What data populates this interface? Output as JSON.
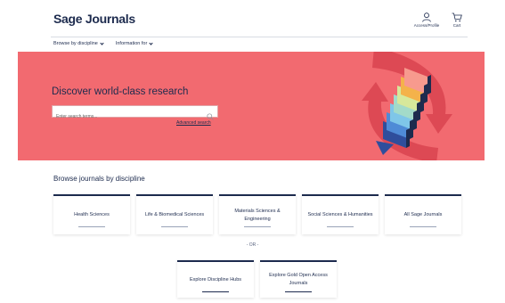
{
  "header": {
    "logo": "Sage Journals",
    "account_label": "Access/Profile",
    "cart_label": "Cart"
  },
  "nav": {
    "items": [
      {
        "label": "Browse by discipline"
      },
      {
        "label": "Information for"
      }
    ]
  },
  "hero": {
    "title": "Discover world-class research",
    "search_placeholder": "Enter search terms...",
    "advanced_search": "Advanced search",
    "background_color": "#f26a70"
  },
  "browse": {
    "title": "Browse journals by discipline",
    "cards": [
      {
        "label": "Health Sciences"
      },
      {
        "label": "Life & Biomedical Sciences"
      },
      {
        "label": "Materials Sciences & Engineering"
      },
      {
        "label": "Social Sciences & Humanities"
      },
      {
        "label": "All Sage Journals"
      }
    ],
    "or_label": "- OR -"
  },
  "explore": {
    "cards": [
      {
        "label": "Explore Discipline Hubs"
      },
      {
        "label": "Explore Gold Open Access Journals"
      }
    ]
  },
  "colors": {
    "brand_navy": "#1d2b4e",
    "hero_coral": "#f26a70"
  }
}
